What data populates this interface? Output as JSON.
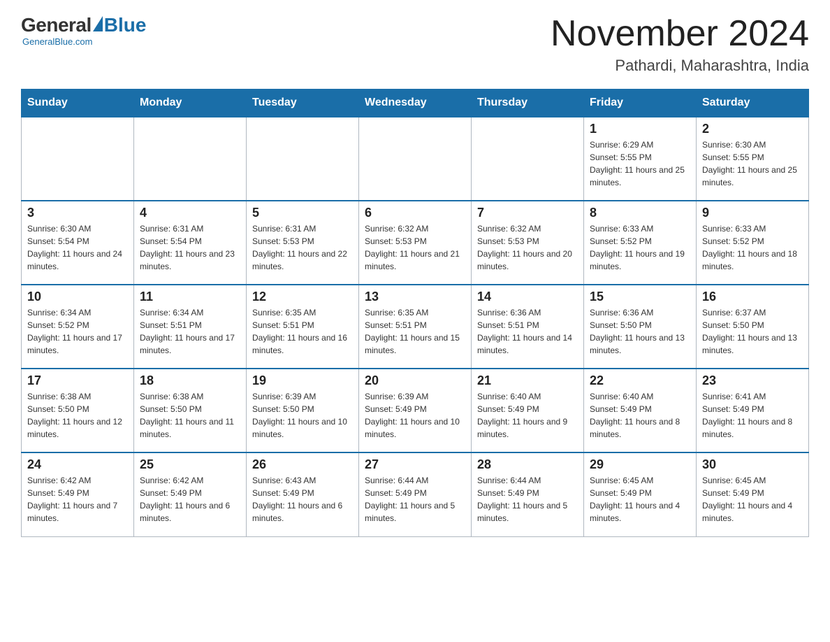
{
  "header": {
    "logo": {
      "general": "General",
      "blue": "Blue",
      "tagline": "GeneralBlue.com"
    },
    "month_title": "November 2024",
    "location": "Pathardi, Maharashtra, India"
  },
  "days_of_week": [
    "Sunday",
    "Monday",
    "Tuesday",
    "Wednesday",
    "Thursday",
    "Friday",
    "Saturday"
  ],
  "weeks": [
    [
      {
        "day": "",
        "info": ""
      },
      {
        "day": "",
        "info": ""
      },
      {
        "day": "",
        "info": ""
      },
      {
        "day": "",
        "info": ""
      },
      {
        "day": "",
        "info": ""
      },
      {
        "day": "1",
        "info": "Sunrise: 6:29 AM\nSunset: 5:55 PM\nDaylight: 11 hours and 25 minutes."
      },
      {
        "day": "2",
        "info": "Sunrise: 6:30 AM\nSunset: 5:55 PM\nDaylight: 11 hours and 25 minutes."
      }
    ],
    [
      {
        "day": "3",
        "info": "Sunrise: 6:30 AM\nSunset: 5:54 PM\nDaylight: 11 hours and 24 minutes."
      },
      {
        "day": "4",
        "info": "Sunrise: 6:31 AM\nSunset: 5:54 PM\nDaylight: 11 hours and 23 minutes."
      },
      {
        "day": "5",
        "info": "Sunrise: 6:31 AM\nSunset: 5:53 PM\nDaylight: 11 hours and 22 minutes."
      },
      {
        "day": "6",
        "info": "Sunrise: 6:32 AM\nSunset: 5:53 PM\nDaylight: 11 hours and 21 minutes."
      },
      {
        "day": "7",
        "info": "Sunrise: 6:32 AM\nSunset: 5:53 PM\nDaylight: 11 hours and 20 minutes."
      },
      {
        "day": "8",
        "info": "Sunrise: 6:33 AM\nSunset: 5:52 PM\nDaylight: 11 hours and 19 minutes."
      },
      {
        "day": "9",
        "info": "Sunrise: 6:33 AM\nSunset: 5:52 PM\nDaylight: 11 hours and 18 minutes."
      }
    ],
    [
      {
        "day": "10",
        "info": "Sunrise: 6:34 AM\nSunset: 5:52 PM\nDaylight: 11 hours and 17 minutes."
      },
      {
        "day": "11",
        "info": "Sunrise: 6:34 AM\nSunset: 5:51 PM\nDaylight: 11 hours and 17 minutes."
      },
      {
        "day": "12",
        "info": "Sunrise: 6:35 AM\nSunset: 5:51 PM\nDaylight: 11 hours and 16 minutes."
      },
      {
        "day": "13",
        "info": "Sunrise: 6:35 AM\nSunset: 5:51 PM\nDaylight: 11 hours and 15 minutes."
      },
      {
        "day": "14",
        "info": "Sunrise: 6:36 AM\nSunset: 5:51 PM\nDaylight: 11 hours and 14 minutes."
      },
      {
        "day": "15",
        "info": "Sunrise: 6:36 AM\nSunset: 5:50 PM\nDaylight: 11 hours and 13 minutes."
      },
      {
        "day": "16",
        "info": "Sunrise: 6:37 AM\nSunset: 5:50 PM\nDaylight: 11 hours and 13 minutes."
      }
    ],
    [
      {
        "day": "17",
        "info": "Sunrise: 6:38 AM\nSunset: 5:50 PM\nDaylight: 11 hours and 12 minutes."
      },
      {
        "day": "18",
        "info": "Sunrise: 6:38 AM\nSunset: 5:50 PM\nDaylight: 11 hours and 11 minutes."
      },
      {
        "day": "19",
        "info": "Sunrise: 6:39 AM\nSunset: 5:50 PM\nDaylight: 11 hours and 10 minutes."
      },
      {
        "day": "20",
        "info": "Sunrise: 6:39 AM\nSunset: 5:49 PM\nDaylight: 11 hours and 10 minutes."
      },
      {
        "day": "21",
        "info": "Sunrise: 6:40 AM\nSunset: 5:49 PM\nDaylight: 11 hours and 9 minutes."
      },
      {
        "day": "22",
        "info": "Sunrise: 6:40 AM\nSunset: 5:49 PM\nDaylight: 11 hours and 8 minutes."
      },
      {
        "day": "23",
        "info": "Sunrise: 6:41 AM\nSunset: 5:49 PM\nDaylight: 11 hours and 8 minutes."
      }
    ],
    [
      {
        "day": "24",
        "info": "Sunrise: 6:42 AM\nSunset: 5:49 PM\nDaylight: 11 hours and 7 minutes."
      },
      {
        "day": "25",
        "info": "Sunrise: 6:42 AM\nSunset: 5:49 PM\nDaylight: 11 hours and 6 minutes."
      },
      {
        "day": "26",
        "info": "Sunrise: 6:43 AM\nSunset: 5:49 PM\nDaylight: 11 hours and 6 minutes."
      },
      {
        "day": "27",
        "info": "Sunrise: 6:44 AM\nSunset: 5:49 PM\nDaylight: 11 hours and 5 minutes."
      },
      {
        "day": "28",
        "info": "Sunrise: 6:44 AM\nSunset: 5:49 PM\nDaylight: 11 hours and 5 minutes."
      },
      {
        "day": "29",
        "info": "Sunrise: 6:45 AM\nSunset: 5:49 PM\nDaylight: 11 hours and 4 minutes."
      },
      {
        "day": "30",
        "info": "Sunrise: 6:45 AM\nSunset: 5:49 PM\nDaylight: 11 hours and 4 minutes."
      }
    ]
  ]
}
